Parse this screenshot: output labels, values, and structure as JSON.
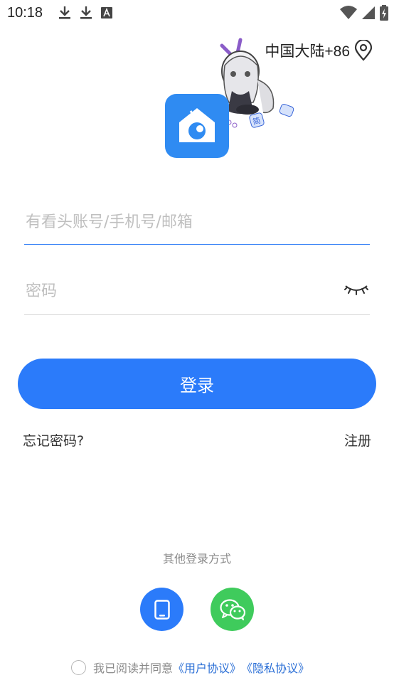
{
  "status_bar": {
    "time": "10:18",
    "left_icons": [
      "download-icon",
      "download-icon",
      "font-a-icon"
    ],
    "right_icons": [
      "wifi-icon",
      "signal-icon",
      "battery-charging-icon"
    ]
  },
  "region": {
    "label": "中国大陆+86",
    "icon": "location-pin-icon"
  },
  "logo": {
    "icon": "app-logo-icon",
    "color": "#2f8bf2"
  },
  "account_field": {
    "value": "",
    "placeholder": "有看头账号/手机号/邮箱"
  },
  "password_field": {
    "value": "",
    "placeholder": "密码",
    "toggle_icon": "eye-closed-icon"
  },
  "login_button": {
    "label": "登录",
    "color": "#2b7bfa"
  },
  "links": {
    "forgot": "忘记密码?",
    "register": "注册"
  },
  "other_login": {
    "label": "其他登录方式",
    "methods": [
      {
        "name": "phone-login",
        "icon": "phone-icon",
        "color": "#2b7bfa"
      },
      {
        "name": "wechat-login",
        "icon": "wechat-icon",
        "color": "#3fcb5c"
      }
    ]
  },
  "agreement": {
    "checked": false,
    "prefix": "我已阅读并同意",
    "user_agreement": "《用户协议》",
    "privacy_policy": "《隐私协议》"
  }
}
